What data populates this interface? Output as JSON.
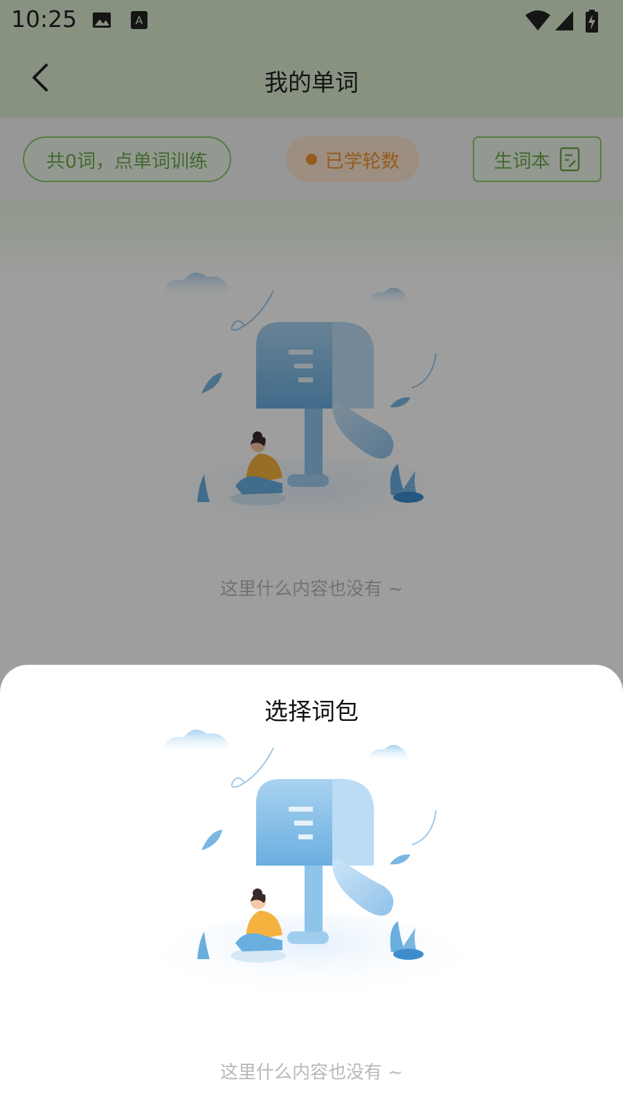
{
  "status_bar": {
    "time": "10:25",
    "icons": [
      "image-icon",
      "a-notification-icon",
      "wifi-icon",
      "signal-icon",
      "battery-charging-icon"
    ]
  },
  "header": {
    "title": "我的单词",
    "back_icon": "back-arrow-icon"
  },
  "filters": {
    "count_label": "共0词，点单词训练",
    "rounds_label": "已学轮数",
    "vocab_book_label": "生词本",
    "vocab_book_icon": "note-edit-icon"
  },
  "empty_state": {
    "message": "这里什么内容也没有 ~",
    "illustration": "mailbox-empty-illustration"
  },
  "bottom_sheet": {
    "title": "选择词包",
    "empty_message": "这里什么内容也没有 ~",
    "illustration": "mailbox-empty-illustration"
  },
  "colors": {
    "header_bg": "#dcecd1",
    "accent_green": "#6fa84d",
    "accent_orange": "#f0932b",
    "pill_orange_bg": "#fde6d2",
    "empty_text": "#b8b8b8"
  }
}
